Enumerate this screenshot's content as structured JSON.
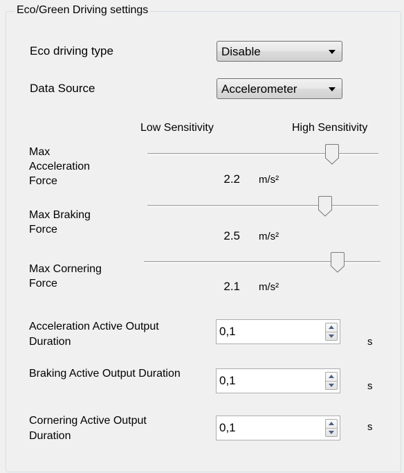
{
  "group": {
    "title": "Eco/Green Driving settings"
  },
  "eco_type": {
    "label": "Eco driving type",
    "value": "Disable"
  },
  "data_source": {
    "label": "Data Source",
    "value": "Accelerometer"
  },
  "scale": {
    "low": "Low Sensitivity",
    "high": "High Sensitivity"
  },
  "sliders": [
    {
      "label": "Max Acceleration Force",
      "value": "2.2",
      "unit": "m/s²",
      "level": 0.8
    },
    {
      "label": "Max Braking Force",
      "value": "2.5",
      "unit": "m/s²",
      "level": 0.77
    },
    {
      "label": "Max Cornering Force",
      "value": "2.1",
      "unit": "m/s²",
      "level": 0.82
    }
  ],
  "durations": [
    {
      "label": "Acceleration Active Output Duration",
      "value": "0,1",
      "unit": "s"
    },
    {
      "label": "Braking Active Output Duration",
      "value": "0,1",
      "unit": "s"
    },
    {
      "label": "Cornering Active Output Duration",
      "value": "0,1",
      "unit": "s"
    }
  ]
}
